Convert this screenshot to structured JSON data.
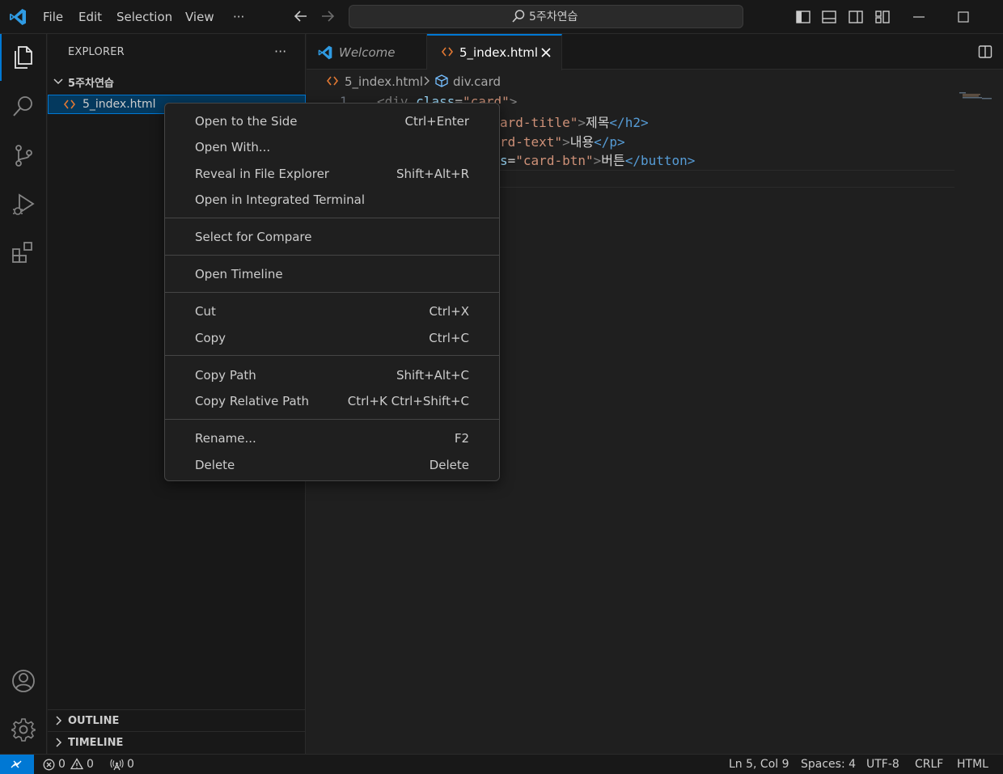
{
  "menu": {
    "items": [
      "File",
      "Edit",
      "Selection",
      "View",
      "···"
    ]
  },
  "search": {
    "text": "5주차연습"
  },
  "explorer": {
    "title": "EXPLORER",
    "more": "···",
    "folder": "5주차연습",
    "file": "5_index.html",
    "sections": [
      "OUTLINE",
      "TIMELINE"
    ]
  },
  "tabs": [
    {
      "label": "Welcome"
    },
    {
      "label": "5_index.html"
    }
  ],
  "breadcrumb": {
    "file": "5_index.html",
    "symbol": "div.card"
  },
  "code": {
    "line1_num": "1",
    "line1_a": "<div ",
    "line1_attr": "class",
    "line1_eq": "=",
    "line1_val": "\"card\"",
    "line1_close": ">",
    "line2_val": "ard-title\"",
    "line2_close": ">",
    "line2_text": "제목",
    "line2_end": "</h2>",
    "line3_val": "rd-text\"",
    "line3_close": ">",
    "line3_text": "내용",
    "line3_end": "</p>",
    "line4_attr": "s",
    "line4_eq": "=",
    "line4_val": "\"card-btn\"",
    "line4_close": ">",
    "line4_text": "버튼",
    "line4_end": "</button>"
  },
  "context_menu": {
    "items": [
      {
        "label": "Open to the Side",
        "key": "Ctrl+Enter"
      },
      {
        "label": "Open With...",
        "key": ""
      },
      {
        "label": "Reveal in File Explorer",
        "key": "Shift+Alt+R"
      },
      {
        "label": "Open in Integrated Terminal",
        "key": ""
      },
      {
        "label": "Select for Compare",
        "key": ""
      },
      {
        "label": "Open Timeline",
        "key": ""
      },
      {
        "label": "Cut",
        "key": "Ctrl+X"
      },
      {
        "label": "Copy",
        "key": "Ctrl+C"
      },
      {
        "label": "Copy Path",
        "key": "Shift+Alt+C"
      },
      {
        "label": "Copy Relative Path",
        "key": "Ctrl+K Ctrl+Shift+C"
      },
      {
        "label": "Rename...",
        "key": "F2"
      },
      {
        "label": "Delete",
        "key": "Delete"
      }
    ]
  },
  "status": {
    "errors": "0",
    "warnings": "0",
    "ports": "0",
    "position": "Ln 5, Col 9",
    "spaces": "Spaces: 4",
    "encoding": "UTF-8",
    "eol": "CRLF",
    "language": "HTML"
  },
  "colors": {
    "accent": "#0078d4",
    "tag": "#569cd6",
    "attr": "#9cdcfe",
    "string": "#ce9178",
    "html_icon": "#e37933"
  }
}
